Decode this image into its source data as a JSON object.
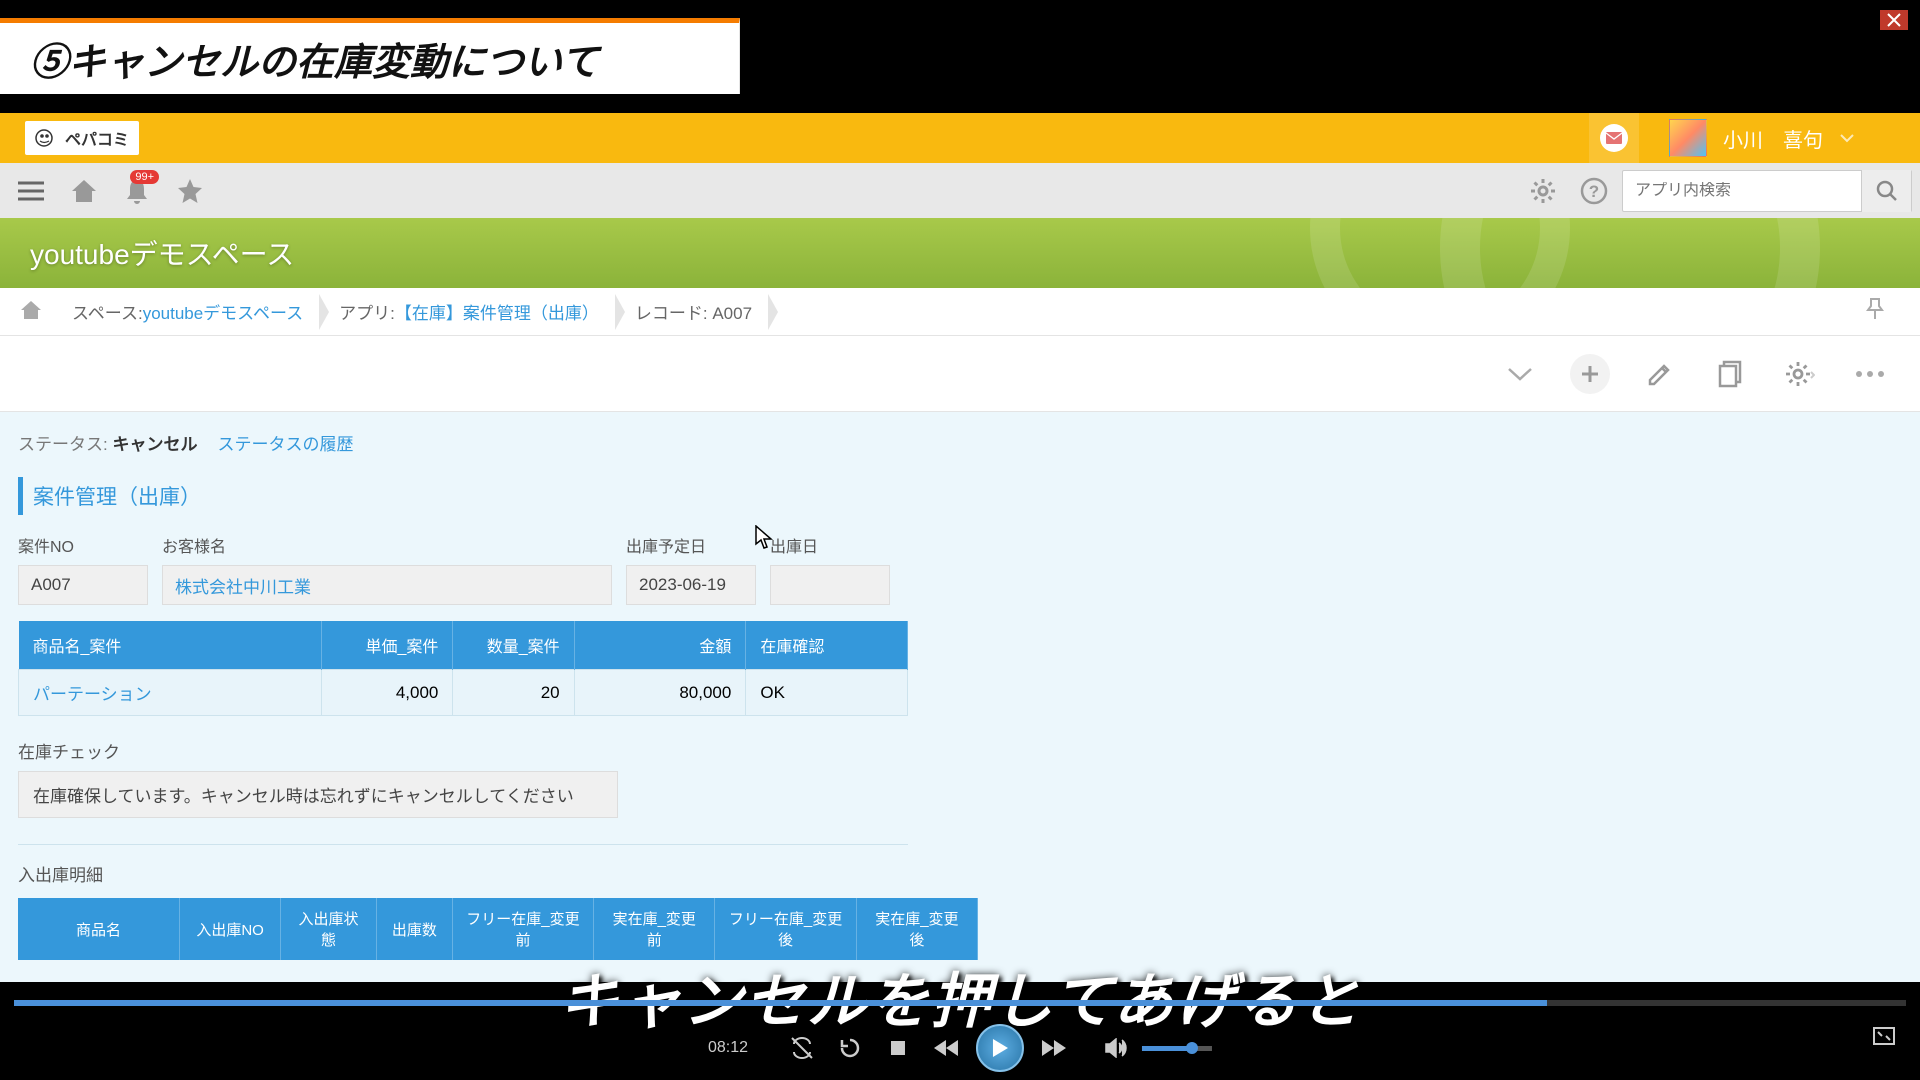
{
  "overlay": {
    "title": "⑤キャンセルの在庫変動について"
  },
  "header": {
    "logo_text": "ペパコミ",
    "user_name": "小川　喜句",
    "notification_badge": "99+"
  },
  "toolbar": {
    "search_placeholder": "アプリ内検索"
  },
  "space": {
    "title": "youtubeデモスペース"
  },
  "breadcrumb": {
    "space_label_prefix": "スペース: ",
    "space_link": "youtubeデモスペース",
    "app_label_prefix": "アプリ: ",
    "app_link": "【在庫】案件管理（出庫）",
    "record_label": "レコード: A007"
  },
  "status": {
    "label": "ステータス: ",
    "value": "キャンセル",
    "history_link": "ステータスの履歴"
  },
  "section": {
    "heading": "案件管理（出庫）"
  },
  "fields": {
    "case_no_label": "案件NO",
    "case_no_value": "A007",
    "customer_label": "お客様名",
    "customer_value": "株式会社中川工業",
    "scheduled_label": "出庫予定日",
    "scheduled_value": "2023-06-19",
    "shipped_label": "出庫日",
    "shipped_value": ""
  },
  "table1": {
    "headers": {
      "product": "商品名_案件",
      "unit_price": "単価_案件",
      "qty": "数量_案件",
      "amount": "金額",
      "stock_check": "在庫確認"
    },
    "row": {
      "product": "パーテーション",
      "unit_price": "4,000",
      "qty": "20",
      "amount": "80,000",
      "stock_check": "OK"
    }
  },
  "stock_check": {
    "label": "在庫チェック",
    "value": "在庫確保しています。キャンセル時は忘れずにキャンセルしてください"
  },
  "detail": {
    "label": "入出庫明細"
  },
  "table2": {
    "headers": {
      "product": "商品名",
      "io_no": "入出庫NO",
      "io_status": "入出庫状態",
      "ship_qty": "出庫数",
      "free_before": "フリー在庫_変更前",
      "actual_before": "実在庫_変更前",
      "free_after": "フリー在庫_変更後",
      "actual_after": "実在庫_変更後"
    }
  },
  "subtitle": {
    "text": "キャンセルを押してあげると"
  },
  "video": {
    "time": "08:12"
  }
}
